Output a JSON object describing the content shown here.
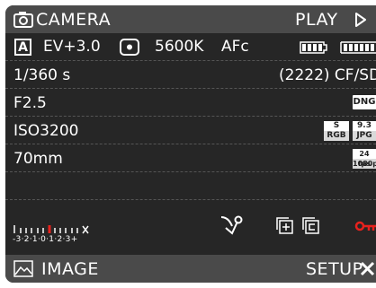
{
  "header": {
    "camera_label": "CAMERA",
    "play_label": "PLAY"
  },
  "status": {
    "exposure_mode": "A",
    "ev_compensation": "EV+3.0",
    "white_balance": "5600K",
    "focus_mode": "AFc",
    "battery_level": 1.0
  },
  "shutter_speed": "1/360 s",
  "shots_remaining": "(2222) CF/SD",
  "aperture": "F2.5",
  "raw_format": "DNG",
  "iso": "ISO3200",
  "jpeg": {
    "color": "S",
    "space": "RGB",
    "quality": "9.3",
    "format": "JPG"
  },
  "focal_length": "70mm",
  "video": {
    "fps": "24 fps",
    "resolution": "1080p"
  },
  "meter": {
    "top": "∘'''''''''''''''''x",
    "bottom": "-3·2·1·0·1·2·3+"
  },
  "footer": {
    "image_label": "IMAGE",
    "setup_label": "SETUP"
  },
  "colors": {
    "accent": "#e8211d",
    "bar": "#4a4a4a",
    "screen": "#262626"
  }
}
